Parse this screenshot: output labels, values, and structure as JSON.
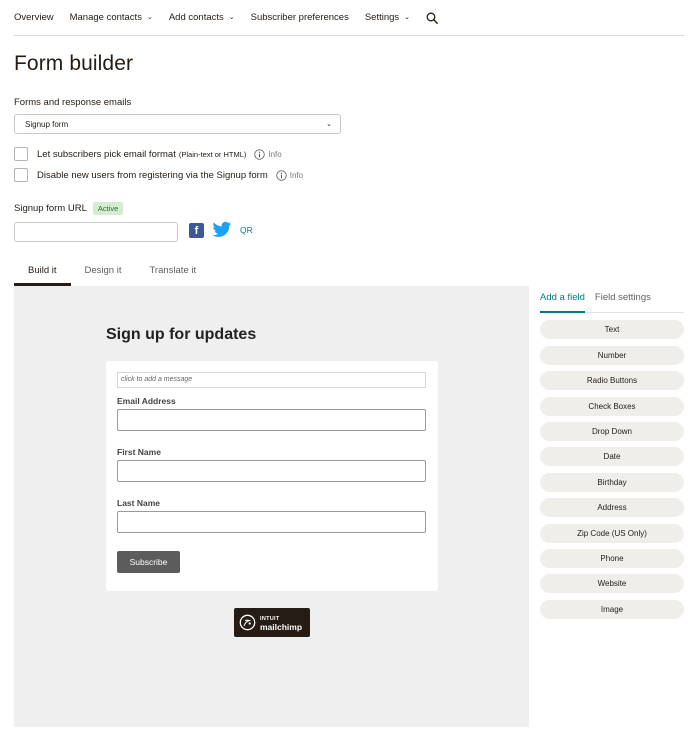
{
  "nav": {
    "items": [
      {
        "label": "Overview",
        "has_dropdown": false
      },
      {
        "label": "Manage contacts",
        "has_dropdown": true
      },
      {
        "label": "Add contacts",
        "has_dropdown": true
      },
      {
        "label": "Subscriber preferences",
        "has_dropdown": false
      },
      {
        "label": "Settings",
        "has_dropdown": true
      }
    ],
    "search_icon": "search-icon"
  },
  "page_title": "Form builder",
  "forms_section": {
    "label": "Forms and response emails",
    "selected_form": "Signup form"
  },
  "options": {
    "email_format_label": "Let subscribers pick email format",
    "email_format_note": "(Plain-text or HTML)",
    "disable_registration_label": "Disable new users from registering via the Signup form",
    "info_label": "Info"
  },
  "signup_url": {
    "label": "Signup form URL",
    "status": "Active",
    "value": "",
    "qr_label": "QR"
  },
  "tabs": [
    {
      "label": "Build it",
      "active": true
    },
    {
      "label": "Design it",
      "active": false
    },
    {
      "label": "Translate it",
      "active": false
    }
  ],
  "preview": {
    "heading": "Sign up for updates",
    "message_placeholder": "click to add a message",
    "fields": [
      {
        "label": "Email Address"
      },
      {
        "label": "First Name"
      },
      {
        "label": "Last Name"
      }
    ],
    "subscribe_label": "Subscribe",
    "logo_line1": "INTUIT",
    "logo_line2": "mailchimp"
  },
  "sidebar": {
    "tabs": [
      {
        "label": "Add a field",
        "active": true
      },
      {
        "label": "Field settings",
        "active": false
      }
    ],
    "field_types": [
      "Text",
      "Number",
      "Radio Buttons",
      "Check Boxes",
      "Drop Down",
      "Date",
      "Birthday",
      "Address",
      "Zip Code (US Only)",
      "Phone",
      "Website",
      "Image"
    ]
  },
  "colors": {
    "accent": "#007c89",
    "text": "#241c15",
    "active_badge_bg": "#d6ecd0",
    "canvas_bg": "#efefef",
    "facebook": "#3b5998",
    "twitter": "#1da1f2"
  }
}
